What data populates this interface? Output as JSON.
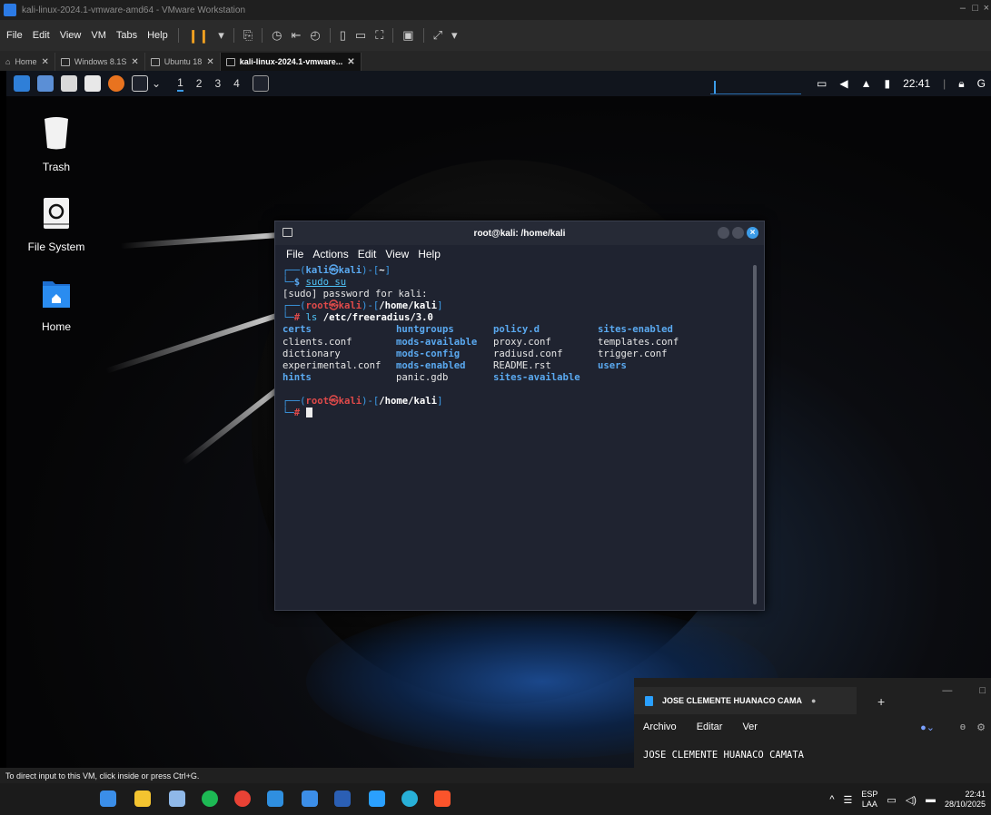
{
  "vm_window": {
    "title": "kali-linux-2024.1-vmware-amd64 - VMware Workstation",
    "menu": [
      "File",
      "Edit",
      "View",
      "VM",
      "Tabs",
      "Help"
    ],
    "tabs": [
      {
        "label": "Home"
      },
      {
        "label": "Windows 8.1S"
      },
      {
        "label": "Ubuntu 18"
      },
      {
        "label": "kali-linux-2024.1-vmware..."
      }
    ],
    "status": "To direct input to this VM, click inside or press Ctrl+G."
  },
  "kali_panel": {
    "workspaces": [
      "1",
      "2",
      "3",
      "4"
    ],
    "clock": "22:41",
    "user_initial": "G"
  },
  "desktop_icons": [
    {
      "label": "Trash"
    },
    {
      "label": "File System"
    },
    {
      "label": "Home"
    }
  ],
  "terminal": {
    "title": "root@kali: /home/kali",
    "menu": [
      "File",
      "Actions",
      "Edit",
      "View",
      "Help"
    ],
    "prompt1_user": "kali",
    "prompt1_host": "kali",
    "prompt1_dir": "~",
    "cmd1": "sudo su",
    "password_line": "[sudo] password for kali:",
    "prompt2_user": "root",
    "prompt2_host": "kali",
    "prompt2_dir": "/home/kali",
    "cmd2_name": "ls",
    "cmd2_arg": "/etc/freeradius/3.0",
    "ls_rows": [
      [
        "certs",
        "huntgroups",
        "policy.d",
        "sites-enabled"
      ],
      [
        "clients.conf",
        "mods-available",
        "proxy.conf",
        "templates.conf"
      ],
      [
        "dictionary",
        "mods-config",
        "radiusd.conf",
        "trigger.conf"
      ],
      [
        "experimental.conf",
        "mods-enabled",
        "README.rst",
        "users"
      ],
      [
        "hints",
        "panic.gdb",
        "sites-available",
        ""
      ]
    ],
    "prompt3_user": "root",
    "prompt3_host": "kali",
    "prompt3_dir": "/home/kali"
  },
  "notepad": {
    "tab_title": "JOSE CLEMENTE HUANACO CAMA",
    "menu": [
      "Archivo",
      "Editar",
      "Ver"
    ],
    "content": "JOSE CLEMENTE HUANACO CAMATA"
  },
  "windows_tray": {
    "lang": "ESP",
    "layout": "LAA",
    "time": "22:41",
    "date": "28/10/2025"
  }
}
